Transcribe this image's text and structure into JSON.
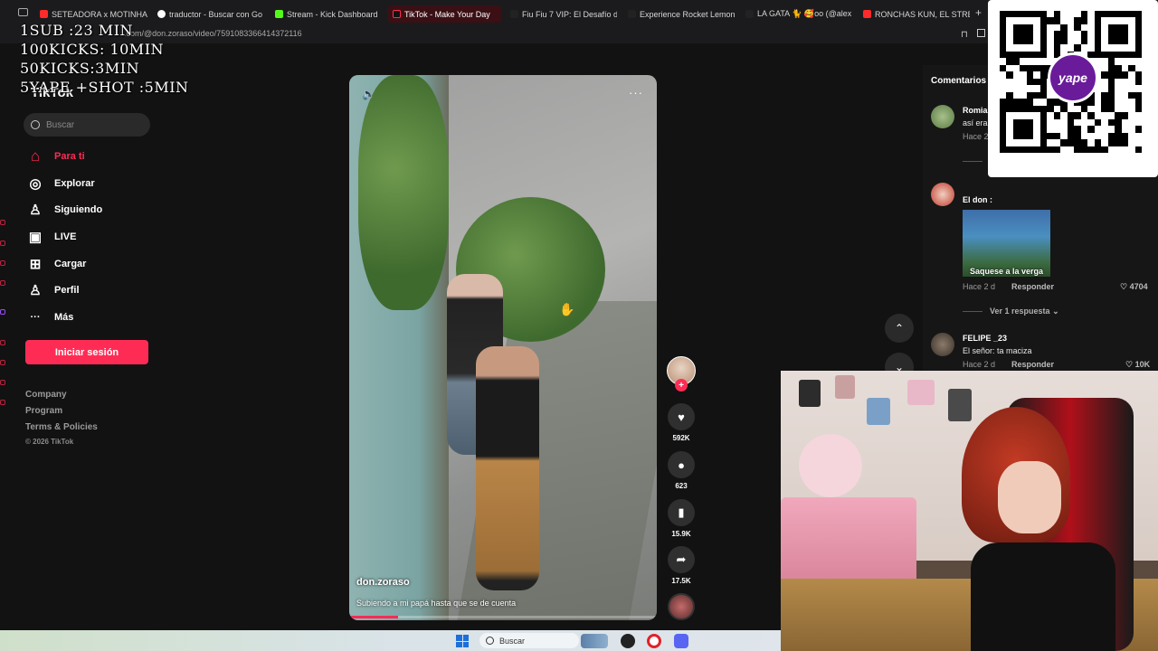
{
  "browser": {
    "tabs": [
      {
        "label": "SETEADORA x MOTINHA",
        "color": "#ff2a2a"
      },
      {
        "label": "traductor - Buscar con Go",
        "color": "#ffffff"
      },
      {
        "label": "Stream - Kick Dashboard",
        "color": "#53fc18"
      },
      {
        "label": "TikTok - Make Your Day",
        "color": "#fe2c55"
      },
      {
        "label": "Fiu Fiu 7 VIP: El Desafío d",
        "color": "#ffffff"
      },
      {
        "label": "Experience Rocket Lemon",
        "color": "#ffffff"
      },
      {
        "label": "LA GATA 🐈 🥰oo (@alex",
        "color": "#ffffff"
      },
      {
        "label": "RONCHAS KUN, EL STREA",
        "color": "#ff2a2a"
      }
    ],
    "url": ".com/@don.zoraso/video/7591083366414372116"
  },
  "overlay": {
    "lines": [
      "1SUB :23 MIN",
      "100KICKS: 10MIN",
      "50KICKS:3MIN",
      "5YAPE +SHOT :5MIN"
    ]
  },
  "tiktok": {
    "logo": "TikTok",
    "search_placeholder": "Buscar",
    "nav": [
      {
        "label": "Para ti",
        "icon": "home-icon",
        "glyph": "⌂"
      },
      {
        "label": "Explorar",
        "icon": "compass-icon",
        "glyph": "◎"
      },
      {
        "label": "Siguiendo",
        "icon": "following-icon",
        "glyph": "♙"
      },
      {
        "label": "LIVE",
        "icon": "live-icon",
        "glyph": "▣"
      },
      {
        "label": "Cargar",
        "icon": "upload-icon",
        "glyph": "⊞"
      },
      {
        "label": "Perfil",
        "icon": "profile-icon",
        "glyph": "♙"
      },
      {
        "label": "Más",
        "icon": "more-icon",
        "glyph": "···"
      }
    ],
    "login_label": "Iniciar sesión",
    "footer": [
      "Company",
      "Program",
      "Terms & Policies"
    ],
    "copyright": "© 2026 TikTok"
  },
  "video": {
    "author": "don.zoraso",
    "caption": "Subiendo a mi papá hasta que se de cuenta",
    "progress": 0.16,
    "likes": "592K",
    "comments": "623",
    "saves": "15.9K",
    "shares": "17.5K"
  },
  "comments": {
    "title": "Comentarios",
    "items": [
      {
        "user": "Romia",
        "text": "así era",
        "time": "Hace 2"
      },
      {
        "user": "El don :",
        "gif_caption": "Saquese a la verga",
        "time": "Hace 2 d",
        "reply": "Responder",
        "likes": "4704",
        "replies_toggle": "Ver 1 respuesta"
      },
      {
        "user": "FELIPE _23",
        "text": "El señor: ta maciza",
        "time": "Hace 2 d",
        "reply": "Responder",
        "likes": "10K"
      }
    ]
  },
  "qr": {
    "brand": "yape"
  },
  "taskbar": {
    "search_placeholder": "Buscar"
  }
}
